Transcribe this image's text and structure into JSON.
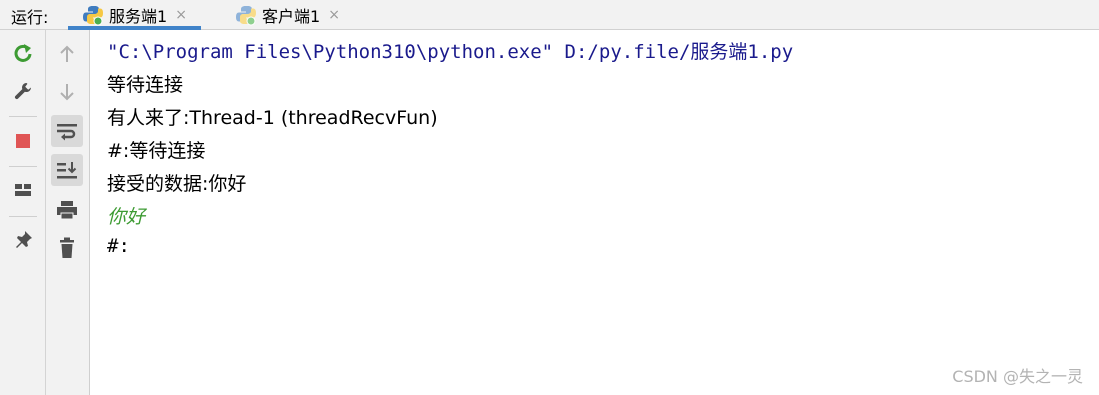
{
  "header": {
    "run_label": "运行:",
    "tabs": [
      {
        "label": "服务端1",
        "close": "×",
        "active": true
      },
      {
        "label": "客户端1",
        "close": "×",
        "active": false
      }
    ]
  },
  "toolbar_left": {
    "icons": [
      "rerun-icon",
      "wrench-icon",
      "stop-icon",
      "layout-icon",
      "pin-icon"
    ]
  },
  "toolbar_right": {
    "icons": [
      "arrow-up-icon",
      "arrow-down-icon",
      "soft-wrap-icon",
      "scroll-to-end-icon",
      "print-icon",
      "trash-icon"
    ]
  },
  "console": {
    "line1": "\"C:\\Program Files\\Python310\\python.exe\" D:/py.file/服务端1.py",
    "line2": "等待连接",
    "line3": "有人来了:Thread-1 (threadRecvFun)",
    "line4": "#:等待连接",
    "line5": "接受的数据:你好",
    "line6": "你好",
    "line7": "#:"
  },
  "watermark": "CSDN @失之一灵",
  "colors": {
    "command_text": "#1a1a8c",
    "input_text": "#3d9b33",
    "rerun_icon": "#3d9b33",
    "stop_icon": "#e05555",
    "tab_underline": "#4083c9"
  }
}
